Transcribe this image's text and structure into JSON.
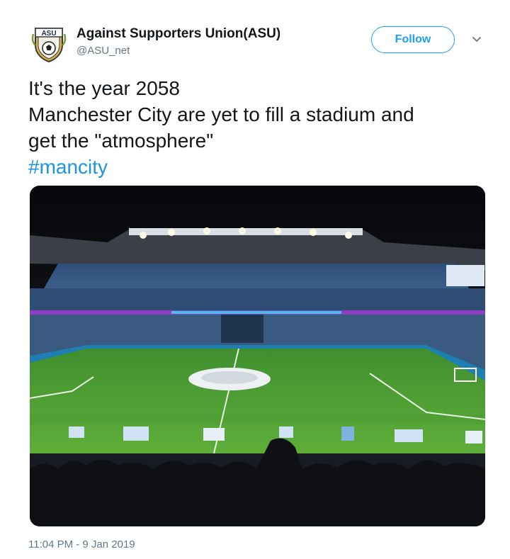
{
  "author": {
    "display_name": "Against Supporters Union(ASU)",
    "handle": "@ASU_net",
    "avatar_icon": "asu-crest-icon",
    "avatar_text": "ASU"
  },
  "follow_label": "Follow",
  "caret_icon": "chevron-down-icon",
  "tweet": {
    "lines": [
      "It's the year 2058",
      "Manchester City are yet to fill a stadium and",
      "get the \"atmosphere\""
    ],
    "hashtag": "#mancity"
  },
  "media": {
    "kind": "photo",
    "subject": "stadium-photo"
  },
  "timestamp": "11:04 PM - 9 Jan 2019",
  "colors": {
    "accent": "#1da1f2",
    "hashtag": "#1b95e0",
    "muted": "#657786",
    "text": "#14171a"
  }
}
